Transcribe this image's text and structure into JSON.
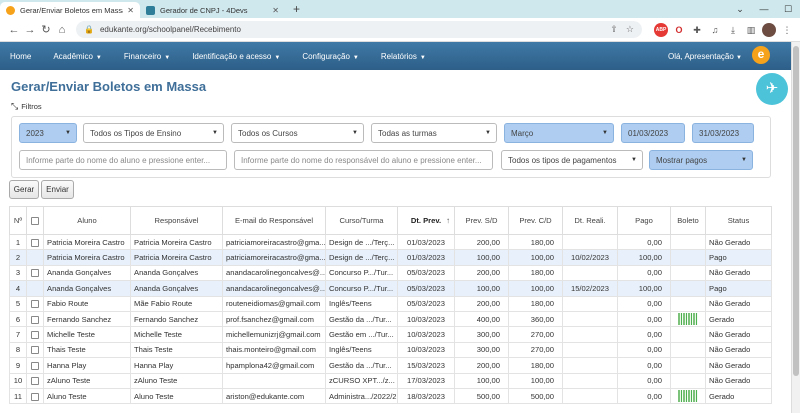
{
  "browser": {
    "tabs": [
      {
        "title": "Gerar/Enviar Boletos em Massa",
        "active": true
      },
      {
        "title": "Gerador de CNPJ - 4Devs",
        "active": false
      }
    ],
    "url": "edukante.org/schoolpanel/Recebimento"
  },
  "nav": {
    "items": [
      "Home",
      "Acadêmico",
      "Financeiro",
      "Identificação e acesso",
      "Configuração",
      "Relatórios"
    ],
    "user": "Olá, Apresentação",
    "logo_letter": "e"
  },
  "page": {
    "title": "Gerar/Enviar Boletos em Massa",
    "filters_label": "Filtros"
  },
  "filters": {
    "year": "2023",
    "ensino": "Todos os Tipos de Ensino",
    "cursos": "Todos os Cursos",
    "turmas": "Todas as turmas",
    "mes": "Março",
    "date_from": "01/03/2023",
    "date_to": "31/03/2023",
    "aluno_placeholder": "Informe parte do nome do aluno e pressione enter...",
    "responsavel_placeholder": "Informe parte do nome do responsável do aluno e pressione enter...",
    "pagamentos": "Todos os tipos de pagamentos",
    "mostrar": "Mostrar pagos"
  },
  "actions": {
    "gerar": "Gerar",
    "enviar": "Enviar"
  },
  "table": {
    "headers": [
      "Nº",
      "",
      "Aluno",
      "Responsável",
      "E-mail do Responsável",
      "Curso/Turma",
      "Dt. Prev.",
      "Prev. S/D",
      "Prev. C/D",
      "Dt. Reali.",
      "Pago",
      "Boleto",
      "Status"
    ],
    "sorted_arrow": "↑",
    "rows": [
      {
        "n": "1",
        "aluno": "Patricia Moreira Castro",
        "resp": "Patricia Moreira Castro",
        "email": "patriciamoreiracastro@gma...",
        "curso": "Design de .../Terç...",
        "dtprev": "01/03/2023",
        "psd": "200,00",
        "pcd": "180,00",
        "dtreal": "",
        "pago": "0,00",
        "boleto": false,
        "status": "Não Gerado",
        "hl": false,
        "cb": true
      },
      {
        "n": "2",
        "aluno": "Patricia Moreira Castro",
        "resp": "Patricia Moreira Castro",
        "email": "patriciamoreiracastro@gma...",
        "curso": "Design de .../Terç...",
        "dtprev": "01/03/2023",
        "psd": "100,00",
        "pcd": "100,00",
        "dtreal": "10/02/2023",
        "pago": "100,00",
        "boleto": false,
        "status": "Pago",
        "hl": true,
        "cb": false
      },
      {
        "n": "3",
        "aluno": "Ananda Gonçalves",
        "resp": "Ananda Gonçalves",
        "email": "anandacarolinegoncalves@...",
        "curso": "Concurso P.../Tur...",
        "dtprev": "05/03/2023",
        "psd": "200,00",
        "pcd": "180,00",
        "dtreal": "",
        "pago": "0,00",
        "boleto": false,
        "status": "Não Gerado",
        "hl": false,
        "cb": true
      },
      {
        "n": "4",
        "aluno": "Ananda Gonçalves",
        "resp": "Ananda Gonçalves",
        "email": "anandacarolinegoncalves@...",
        "curso": "Concurso P.../Tur...",
        "dtprev": "05/03/2023",
        "psd": "100,00",
        "pcd": "100,00",
        "dtreal": "15/02/2023",
        "pago": "100,00",
        "boleto": false,
        "status": "Pago",
        "hl": true,
        "cb": false
      },
      {
        "n": "5",
        "aluno": "Fabio Route",
        "resp": "Mãe Fabio Route",
        "email": "routeneidiomas@gmail.com",
        "curso": "Inglês/Teens",
        "dtprev": "05/03/2023",
        "psd": "200,00",
        "pcd": "180,00",
        "dtreal": "",
        "pago": "0,00",
        "boleto": false,
        "status": "Não Gerado",
        "hl": false,
        "cb": true
      },
      {
        "n": "6",
        "aluno": "Fernando Sanchez",
        "resp": "Fernando Sanchez",
        "email": "prof.fsanchez@gmail.com",
        "curso": "Gestão da .../Tur...",
        "dtprev": "10/03/2023",
        "psd": "400,00",
        "pcd": "360,00",
        "dtreal": "",
        "pago": "0,00",
        "boleto": true,
        "status": "Gerado",
        "hl": false,
        "cb": true
      },
      {
        "n": "7",
        "aluno": "Michelle Teste",
        "resp": "Michelle Teste",
        "email": "michellemunizrj@gmail.com",
        "curso": "Gestão em .../Tur...",
        "dtprev": "10/03/2023",
        "psd": "300,00",
        "pcd": "270,00",
        "dtreal": "",
        "pago": "0,00",
        "boleto": false,
        "status": "Não Gerado",
        "hl": false,
        "cb": true
      },
      {
        "n": "8",
        "aluno": "Thais Teste",
        "resp": "Thais Teste",
        "email": "thais.monteiro@gmail.com",
        "curso": "Inglês/Teens",
        "dtprev": "10/03/2023",
        "psd": "300,00",
        "pcd": "270,00",
        "dtreal": "",
        "pago": "0,00",
        "boleto": false,
        "status": "Não Gerado",
        "hl": false,
        "cb": true
      },
      {
        "n": "9",
        "aluno": "Hanna Play",
        "resp": "Hanna Play",
        "email": "hpamplona42@gmail.com",
        "curso": "Gestão da .../Tur...",
        "dtprev": "15/03/2023",
        "psd": "200,00",
        "pcd": "180,00",
        "dtreal": "",
        "pago": "0,00",
        "boleto": false,
        "status": "Não Gerado",
        "hl": false,
        "cb": true
      },
      {
        "n": "10",
        "aluno": "zAluno Teste",
        "resp": "zAluno Teste",
        "email": "",
        "curso": "zCURSO XPT.../z...",
        "dtprev": "17/03/2023",
        "psd": "100,00",
        "pcd": "100,00",
        "dtreal": "",
        "pago": "0,00",
        "boleto": false,
        "status": "Não Gerado",
        "hl": false,
        "cb": true
      },
      {
        "n": "11",
        "aluno": "Aluno Teste",
        "resp": "Aluno Teste",
        "email": "ariston@edukante.com",
        "curso": "Administra.../2022/2",
        "dtprev": "18/03/2023",
        "psd": "500,00",
        "pcd": "500,00",
        "dtreal": "",
        "pago": "0,00",
        "boleto": true,
        "status": "Gerado",
        "hl": false,
        "cb": true
      }
    ]
  }
}
